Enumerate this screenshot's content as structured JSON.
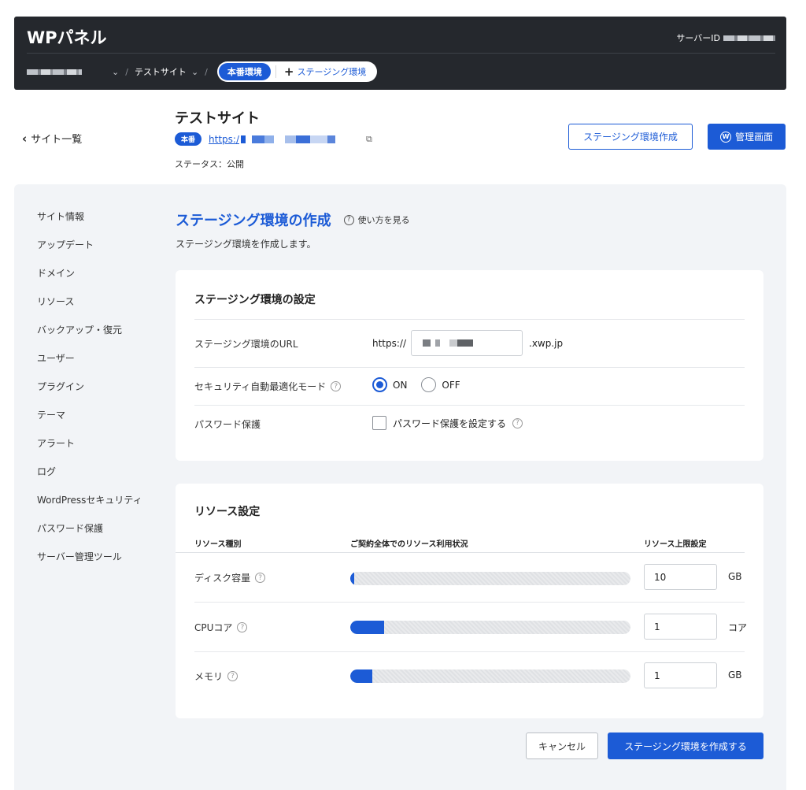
{
  "header": {
    "logo": "WPパネル",
    "server_id_label": "サーバーID",
    "breadcrumb_site": "テストサイト",
    "env_active": "本番環境",
    "env_add": "ステージング環境"
  },
  "site": {
    "back_label": "サイト一覧",
    "title": "テストサイト",
    "badge": "本番",
    "url_prefix": "https:/",
    "status": "ステータス：公開",
    "btn_staging": "ステージング環境作成",
    "btn_admin": "管理画面"
  },
  "sidebar": {
    "items": [
      {
        "label": "サイト情報"
      },
      {
        "label": "アップデート"
      },
      {
        "label": "ドメイン"
      },
      {
        "label": "リソース"
      },
      {
        "label": "バックアップ・復元"
      },
      {
        "label": "ユーザー"
      },
      {
        "label": "プラグイン"
      },
      {
        "label": "テーマ"
      },
      {
        "label": "アラート"
      },
      {
        "label": "ログ"
      },
      {
        "label": "WordPressセキュリティ"
      },
      {
        "label": "パスワード保護"
      },
      {
        "label": "サーバー管理ツール"
      }
    ]
  },
  "main": {
    "title": "ステージング環境の作成",
    "howto": "使い方を見る",
    "description": "ステージング環境を作成します。"
  },
  "settings": {
    "title": "ステージング環境の設定",
    "url_label": "ステージング環境のURL",
    "url_prefix": "https://",
    "url_suffix": ".xwp.jp",
    "security_label": "セキュリティ自動最適化モード",
    "on_label": "ON",
    "off_label": "OFF",
    "password_label": "パスワード保護",
    "password_checkbox": "パスワード保護を設定する"
  },
  "resources": {
    "title": "リソース設定",
    "col_type": "リソース種別",
    "col_usage": "ご契約全体でのリソース利用状況",
    "col_limit": "リソース上限設定",
    "rows": [
      {
        "label": "ディスク容量",
        "usage": 0.015,
        "value": "10",
        "unit": "GB"
      },
      {
        "label": "CPUコア",
        "usage": 0.12,
        "value": "1",
        "unit": "コア"
      },
      {
        "label": "メモリ",
        "usage": 0.08,
        "value": "1",
        "unit": "GB"
      }
    ]
  },
  "footer": {
    "cancel": "キャンセル",
    "create": "ステージング環境を作成する"
  },
  "colors": {
    "accent": "#1c5bd6",
    "header_bg": "#25282d",
    "panel_bg": "#f2f4f7"
  }
}
